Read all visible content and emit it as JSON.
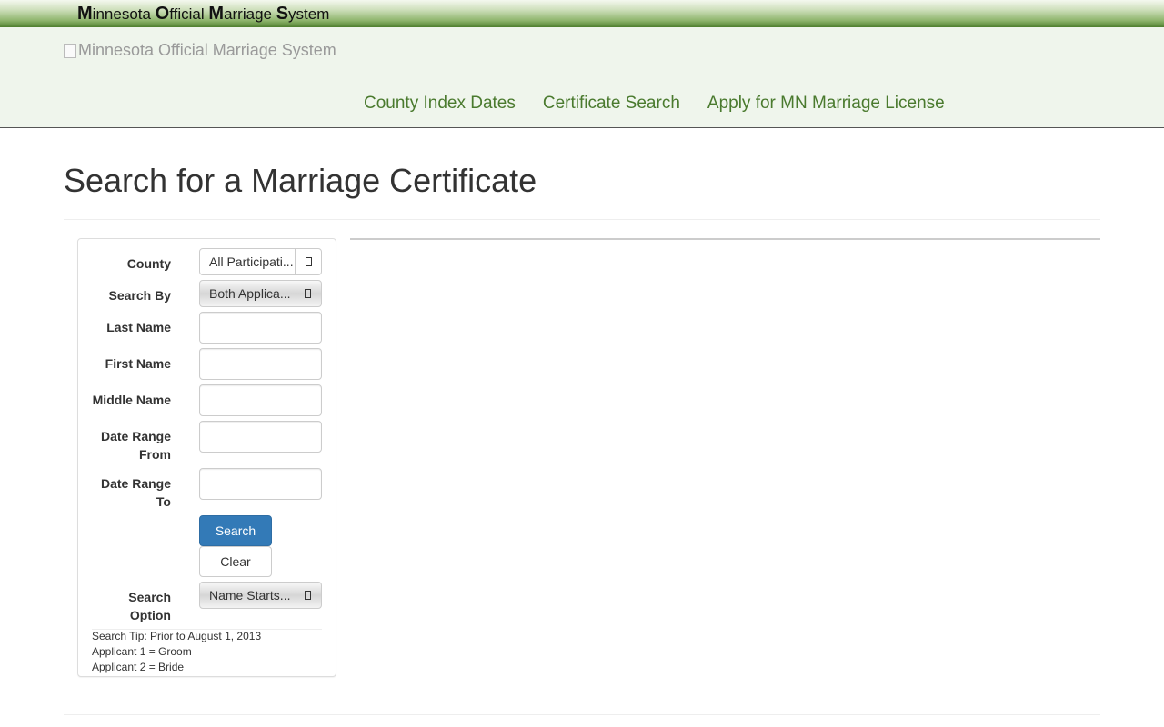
{
  "topbar": {
    "brand_parts": [
      {
        "initial": "M",
        "rest": "innesota "
      },
      {
        "initial": "O",
        "rest": "fficial "
      },
      {
        "initial": "M",
        "rest": "arriage "
      },
      {
        "initial": "S",
        "rest": "ystem"
      }
    ]
  },
  "header": {
    "logo_alt": "Minnesota Official Marriage System",
    "nav": [
      {
        "label": "County Index Dates"
      },
      {
        "label": "Certificate Search"
      },
      {
        "label": "Apply for MN Marriage License"
      }
    ]
  },
  "page": {
    "title": "Search for a Marriage Certificate"
  },
  "form": {
    "county": {
      "label": "County",
      "value": "All Participati..."
    },
    "search_by": {
      "label": "Search By",
      "value": "Both Applica..."
    },
    "last_name": {
      "label": "Last Name",
      "value": ""
    },
    "first_name": {
      "label": "First Name",
      "value": ""
    },
    "middle_name": {
      "label": "Middle Name",
      "value": ""
    },
    "date_from": {
      "label_line1": "Date Range",
      "label_line2": "From",
      "value": ""
    },
    "date_to": {
      "label_line1": "Date Range",
      "label_line2": "To",
      "value": ""
    },
    "search_button": "Search",
    "clear_button": "Clear",
    "search_option": {
      "label_line1": "Search",
      "label_line2": "Option",
      "value": "Name Starts..."
    },
    "tips": [
      "Search Tip: Prior to August 1, 2013",
      "Applicant 1 = Groom",
      "Applicant 2 = Bride"
    ]
  },
  "icons": {
    "dropdown": "chevron-down-icon",
    "broken_image": "broken-image-icon"
  },
  "colors": {
    "header_bg": "#eff5ec",
    "nav_link": "#4a7a2e",
    "primary_button": "#337ab7"
  }
}
